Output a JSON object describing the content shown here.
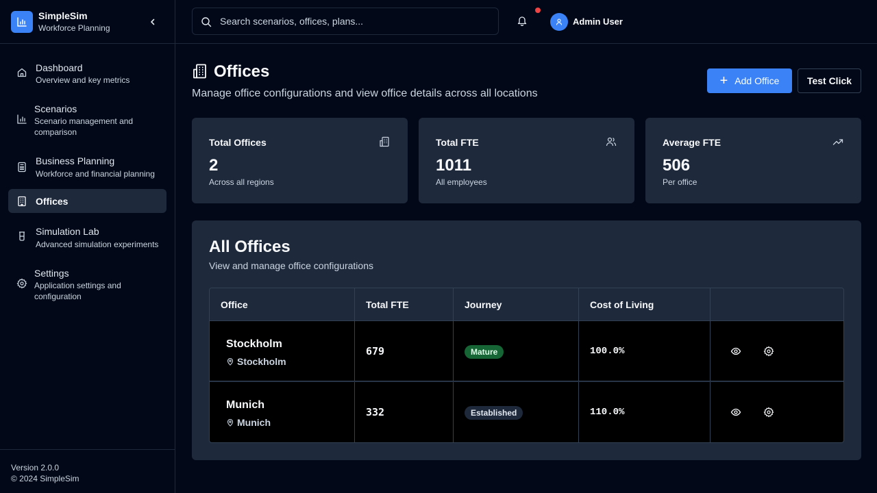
{
  "brand": {
    "name": "SimpleSim",
    "subtitle": "Workforce Planning"
  },
  "nav": [
    {
      "label": "Dashboard",
      "desc": "Overview and key metrics",
      "icon": "home-icon"
    },
    {
      "label": "Scenarios",
      "desc": "Scenario management and comparison",
      "icon": "bar-chart-icon"
    },
    {
      "label": "Business Planning",
      "desc": "Workforce and financial planning",
      "icon": "calculator-icon"
    },
    {
      "label": "Offices",
      "desc": "",
      "icon": "building-icon",
      "active": true
    },
    {
      "label": "Simulation Lab",
      "desc": "Advanced simulation experiments",
      "icon": "beaker-icon"
    },
    {
      "label": "Settings",
      "desc": "Application settings and configuration",
      "icon": "gear-icon"
    }
  ],
  "footer": {
    "version": "Version 2.0.0",
    "copyright": "© 2024 SimpleSim"
  },
  "topbar": {
    "search_placeholder": "Search scenarios, offices, plans...",
    "user_name": "Admin User"
  },
  "page": {
    "title": "Offices",
    "subtitle": "Manage office configurations and view office details across all locations",
    "add_button": "Add Office",
    "test_button": "Test Click"
  },
  "stats": [
    {
      "title": "Total Offices",
      "value": "2",
      "desc": "Across all regions",
      "icon": "building-icon"
    },
    {
      "title": "Total FTE",
      "value": "1011",
      "desc": "All employees",
      "icon": "users-icon"
    },
    {
      "title": "Average FTE",
      "value": "506",
      "desc": "Per office",
      "icon": "trending-up-icon"
    }
  ],
  "panel": {
    "title": "All Offices",
    "subtitle": "View and manage office configurations",
    "columns": [
      "Office",
      "Total FTE",
      "Journey",
      "Cost of Living",
      ""
    ],
    "rows": [
      {
        "office": "Stockholm",
        "location": "Stockholm",
        "fte": "679",
        "journey": "Mature",
        "col": "100.0%"
      },
      {
        "office": "Munich",
        "location": "Munich",
        "fte": "332",
        "journey": "Established",
        "col": "110.0%"
      }
    ]
  },
  "colors": {
    "accent": "#3b82f6",
    "background": "#020817",
    "card": "#1e293b",
    "mature_badge": "#166534",
    "notification": "#ef4444"
  }
}
